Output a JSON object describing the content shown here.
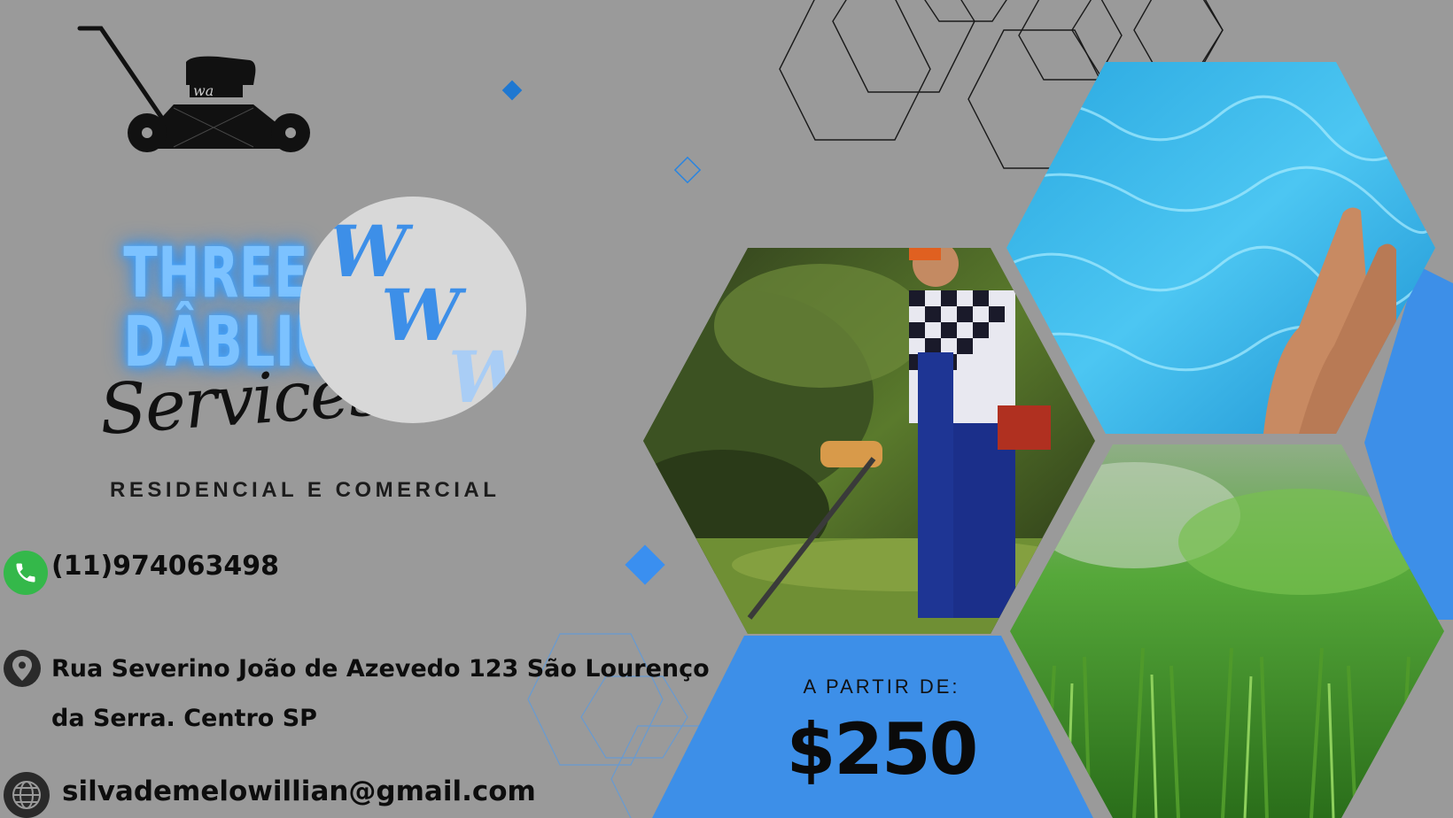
{
  "brand": {
    "title_line1": "THREE",
    "title_line2": "DÂBLIUS",
    "services_script": "Services",
    "tagline": "RESIDENCIAL E COMERCIAL",
    "logo_letters": [
      "W",
      "W",
      "W"
    ],
    "mower_label": "wa"
  },
  "contact": {
    "phone": "(11)974063498",
    "address_line1": "Rua Severino João de Azevedo 123 São Lourenço",
    "address_line2": "da Serra. Centro SP",
    "email": "silvademelowillian@gmail.com"
  },
  "price": {
    "label": "A PARTIR DE:",
    "value": "$250"
  },
  "icons": {
    "mower": "lawn-mower-icon",
    "phone": "phone-icon",
    "location": "map-pin-icon",
    "web": "globe-icon"
  },
  "colors": {
    "background": "#9a9a9a",
    "accent_blue": "#3d8fe8",
    "glow_blue": "#7cc2ff",
    "phone_green": "#34b84a"
  }
}
